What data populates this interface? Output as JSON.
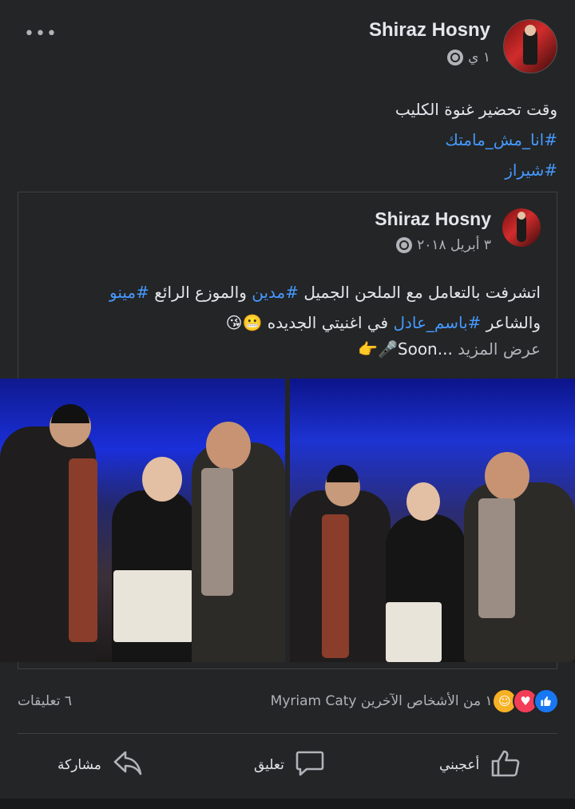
{
  "post": {
    "author": "Shiraz Hosny",
    "time": "١ ي",
    "text_line1": "وقت تحضير غنوة الكليب",
    "hashtag1": "#انا_مش_مامتك",
    "hashtag2": "#شيراز"
  },
  "shared": {
    "author": "Shiraz Hosny",
    "date": "٣ أبريل ٢٠١٨",
    "line1_a": "اتشرفت بالتعامل مع الملحن الجميل ",
    "line1_tag1": "#مدين",
    "line1_b": " والموزع الرائع ",
    "line1_tag2": "#مينو",
    "line2_a": "والشاعر ",
    "line2_tag": "#باسم_عادل",
    "line2_b": " في اغنيتي الجديده 😬😘",
    "soon": "👉🎤Soon...",
    "see_more": "عرض المزيد"
  },
  "stats": {
    "reactions_text": "Myriam Caty و١٦ من الأشخاص الآخرين",
    "comments": "٦ تعليقات"
  },
  "actions": {
    "like": "أعجبني",
    "comment": "تعليق",
    "share": "مشاركة"
  },
  "colors": {
    "background": "#242526",
    "hashtag": "#4599ff",
    "like_blue": "#1877f2",
    "love_red": "#f33e58",
    "care_yellow": "#f7b125"
  },
  "icons": {
    "more": "more-dots-icon",
    "privacy": "globe-icon",
    "like": "thumbs-up-icon",
    "comment": "comment-bubble-icon",
    "share": "share-arrow-icon"
  }
}
